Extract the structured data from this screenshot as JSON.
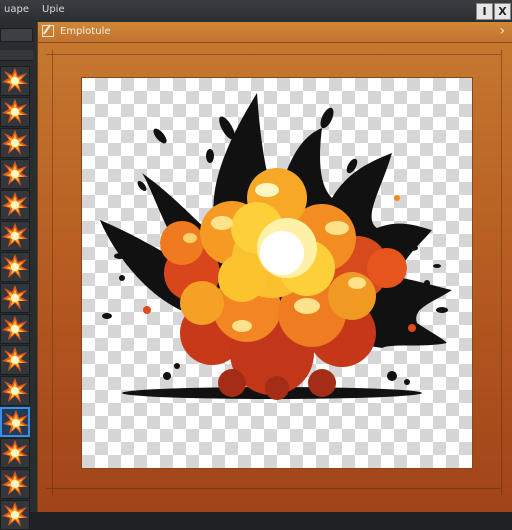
{
  "topbar": {
    "left_label": "uape",
    "center_label": "Upie",
    "button_1": "I",
    "button_2": "X"
  },
  "document": {
    "title": "Emplotule",
    "close_glyph": "›"
  },
  "colors": {
    "window_accent": "#c77a30",
    "selection_blue": "#3b8ee8",
    "panel_dark": "#2a2d30"
  },
  "thumbnails": {
    "count": 15,
    "active_index": 11
  }
}
